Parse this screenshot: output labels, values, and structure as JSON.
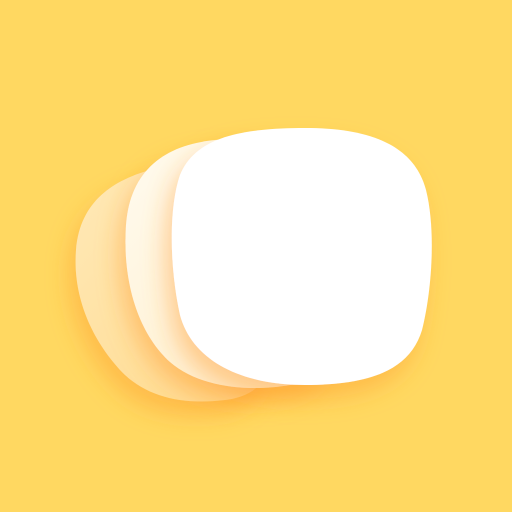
{
  "icon": {
    "name": "stacked-cards-app-icon",
    "background_color": "#FFD861",
    "card_colors": {
      "back": "#FFE3A6",
      "middle": "#FFF3D8",
      "front": "#FFFFFF",
      "shadow": "#FF9A2E"
    }
  }
}
